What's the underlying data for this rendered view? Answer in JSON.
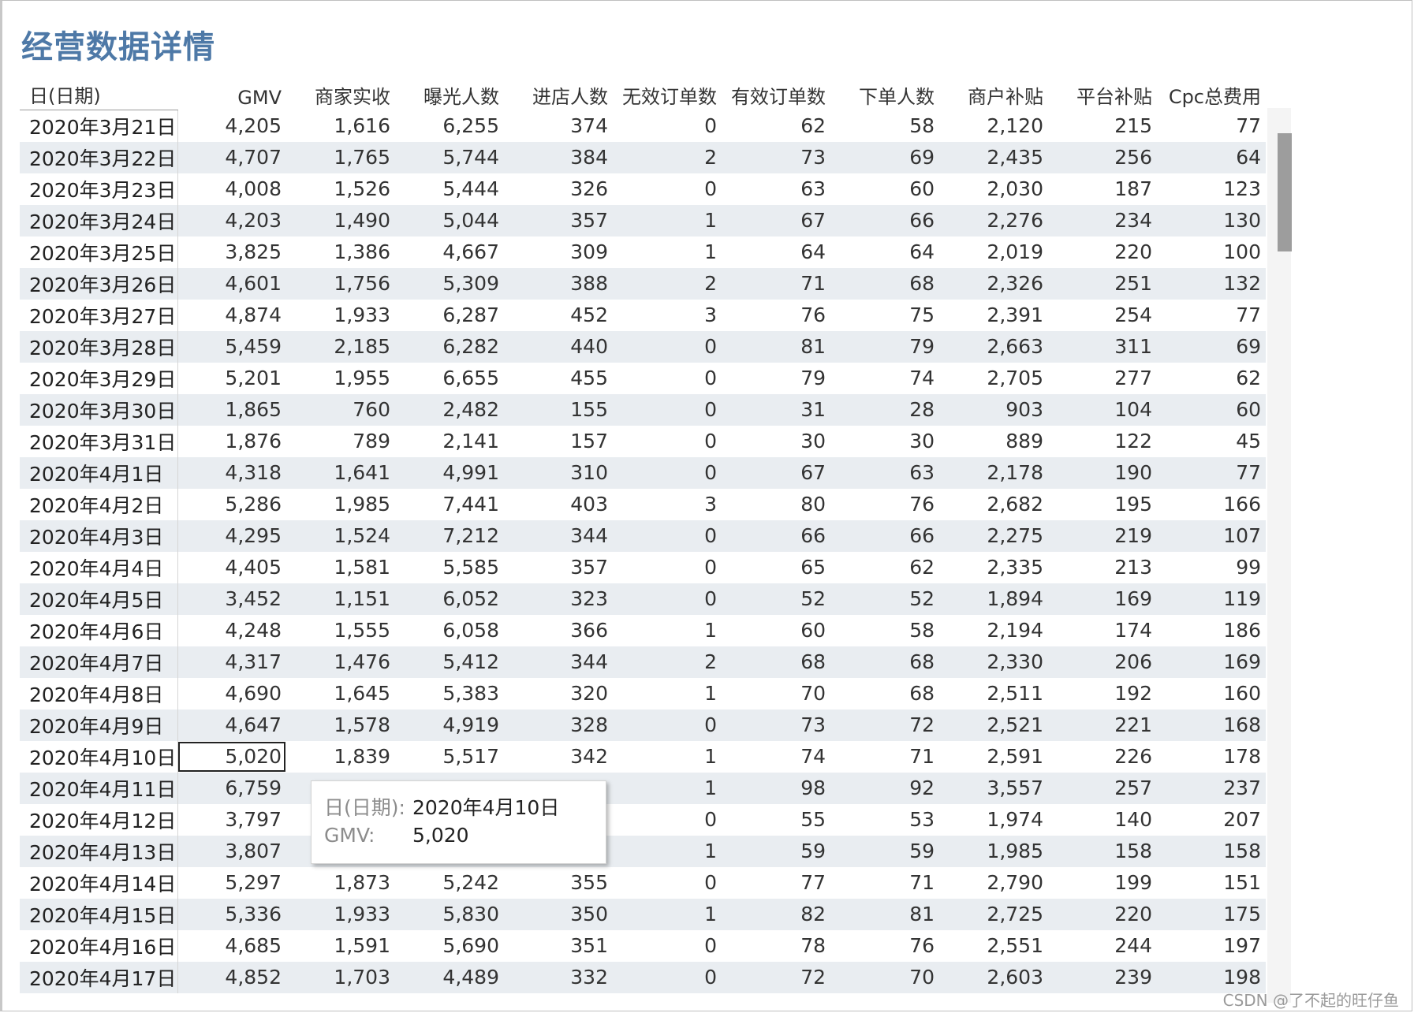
{
  "title": "经营数据详情",
  "columns": [
    "日(日期)",
    "GMV",
    "商家实收",
    "曝光人数",
    "进店人数",
    "无效订单数",
    "有效订单数",
    "下单人数",
    "商户补贴",
    "平台补贴",
    "Cpc总费用"
  ],
  "rows": [
    [
      "2020年3月21日",
      "4,205",
      "1,616",
      "6,255",
      "374",
      "0",
      "62",
      "58",
      "2,120",
      "215",
      "77"
    ],
    [
      "2020年3月22日",
      "4,707",
      "1,765",
      "5,744",
      "384",
      "2",
      "73",
      "69",
      "2,435",
      "256",
      "64"
    ],
    [
      "2020年3月23日",
      "4,008",
      "1,526",
      "5,444",
      "326",
      "0",
      "63",
      "60",
      "2,030",
      "187",
      "123"
    ],
    [
      "2020年3月24日",
      "4,203",
      "1,490",
      "5,044",
      "357",
      "1",
      "67",
      "66",
      "2,276",
      "234",
      "130"
    ],
    [
      "2020年3月25日",
      "3,825",
      "1,386",
      "4,667",
      "309",
      "1",
      "64",
      "64",
      "2,019",
      "220",
      "100"
    ],
    [
      "2020年3月26日",
      "4,601",
      "1,756",
      "5,309",
      "388",
      "2",
      "71",
      "68",
      "2,326",
      "251",
      "132"
    ],
    [
      "2020年3月27日",
      "4,874",
      "1,933",
      "6,287",
      "452",
      "3",
      "76",
      "75",
      "2,391",
      "254",
      "77"
    ],
    [
      "2020年3月28日",
      "5,459",
      "2,185",
      "6,282",
      "440",
      "0",
      "81",
      "79",
      "2,663",
      "311",
      "69"
    ],
    [
      "2020年3月29日",
      "5,201",
      "1,955",
      "6,655",
      "455",
      "0",
      "79",
      "74",
      "2,705",
      "277",
      "62"
    ],
    [
      "2020年3月30日",
      "1,865",
      "760",
      "2,482",
      "155",
      "0",
      "31",
      "28",
      "903",
      "104",
      "60"
    ],
    [
      "2020年3月31日",
      "1,876",
      "789",
      "2,141",
      "157",
      "0",
      "30",
      "30",
      "889",
      "122",
      "45"
    ],
    [
      "2020年4月1日",
      "4,318",
      "1,641",
      "4,991",
      "310",
      "0",
      "67",
      "63",
      "2,178",
      "190",
      "77"
    ],
    [
      "2020年4月2日",
      "5,286",
      "1,985",
      "7,441",
      "403",
      "3",
      "80",
      "76",
      "2,682",
      "195",
      "166"
    ],
    [
      "2020年4月3日",
      "4,295",
      "1,524",
      "7,212",
      "344",
      "0",
      "66",
      "66",
      "2,275",
      "219",
      "107"
    ],
    [
      "2020年4月4日",
      "4,405",
      "1,581",
      "5,585",
      "357",
      "0",
      "65",
      "62",
      "2,335",
      "213",
      "99"
    ],
    [
      "2020年4月5日",
      "3,452",
      "1,151",
      "6,052",
      "323",
      "0",
      "52",
      "52",
      "1,894",
      "169",
      "119"
    ],
    [
      "2020年4月6日",
      "4,248",
      "1,555",
      "6,058",
      "366",
      "1",
      "60",
      "58",
      "2,194",
      "174",
      "186"
    ],
    [
      "2020年4月7日",
      "4,317",
      "1,476",
      "5,412",
      "344",
      "2",
      "68",
      "68",
      "2,330",
      "206",
      "169"
    ],
    [
      "2020年4月8日",
      "4,690",
      "1,645",
      "5,383",
      "320",
      "1",
      "70",
      "68",
      "2,511",
      "192",
      "160"
    ],
    [
      "2020年4月9日",
      "4,647",
      "1,578",
      "4,919",
      "328",
      "0",
      "73",
      "72",
      "2,521",
      "221",
      "168"
    ],
    [
      "2020年4月10日",
      "5,020",
      "1,839",
      "5,517",
      "342",
      "1",
      "74",
      "71",
      "2,591",
      "226",
      "178"
    ],
    [
      "2020年4月11日",
      "6,759",
      "",
      "",
      "",
      "1",
      "98",
      "92",
      "3,557",
      "257",
      "237"
    ],
    [
      "2020年4月12日",
      "3,797",
      "",
      "",
      "",
      "0",
      "55",
      "53",
      "1,974",
      "140",
      "207"
    ],
    [
      "2020年4月13日",
      "3,807",
      "",
      "",
      "",
      "1",
      "59",
      "59",
      "1,985",
      "158",
      "158"
    ],
    [
      "2020年4月14日",
      "5,297",
      "1,873",
      "5,242",
      "355",
      "0",
      "77",
      "71",
      "2,790",
      "199",
      "151"
    ],
    [
      "2020年4月15日",
      "5,336",
      "1,933",
      "5,830",
      "350",
      "1",
      "82",
      "81",
      "2,725",
      "220",
      "175"
    ],
    [
      "2020年4月16日",
      "4,685",
      "1,591",
      "5,690",
      "351",
      "0",
      "78",
      "76",
      "2,551",
      "244",
      "197"
    ],
    [
      "2020年4月17日",
      "4,852",
      "1,703",
      "4,489",
      "332",
      "0",
      "72",
      "70",
      "2,603",
      "239",
      "198"
    ]
  ],
  "selected_row": 20,
  "tooltip": {
    "date_label": "日(日期):",
    "date_value": "2020年4月10日",
    "gmv_label": "GMV:",
    "gmv_value": "5,020"
  },
  "watermark": "CSDN @了不起的旺仔鱼",
  "colors": {
    "title": "#4e79a7",
    "band": "#e9edf1"
  }
}
